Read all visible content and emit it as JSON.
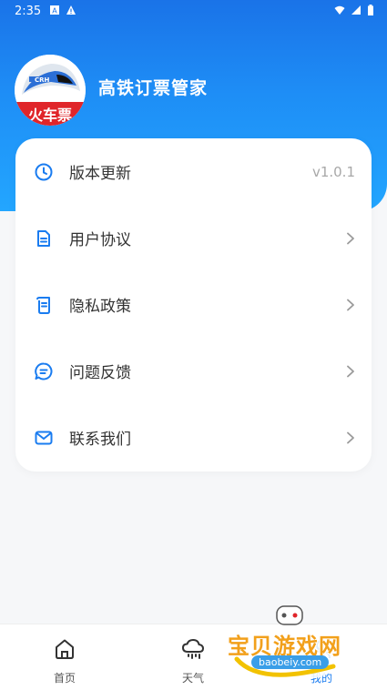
{
  "status_bar": {
    "time": "2:35"
  },
  "app": {
    "title": "高铁订票管家",
    "logo_text": "火车票",
    "logo_badge": "CRH"
  },
  "menu": {
    "items": [
      {
        "label": "版本更新",
        "value": "v1.0.1",
        "icon": "clock-icon"
      },
      {
        "label": "用户协议",
        "icon": "document-icon"
      },
      {
        "label": "隐私政策",
        "icon": "scroll-icon"
      },
      {
        "label": "问题反馈",
        "icon": "chat-icon"
      },
      {
        "label": "联系我们",
        "icon": "mail-icon"
      }
    ]
  },
  "bottom_nav": {
    "tabs": [
      {
        "label": "首页",
        "icon": "home-icon"
      },
      {
        "label": "天气",
        "icon": "rain-cloud-icon"
      },
      {
        "label": "我的",
        "icon": "user-icon",
        "active": true
      }
    ]
  },
  "watermark": {
    "text": "宝贝游戏网",
    "url": "baobeiy.com"
  },
  "colors": {
    "accent": "#1a7cf0",
    "header_top": "#1a73e8",
    "header_bottom": "#23a6ff"
  }
}
